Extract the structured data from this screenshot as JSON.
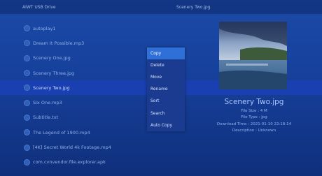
{
  "header": {
    "path": "AIWT USB Drive",
    "title": "Scenery Two.jpg"
  },
  "files": [
    {
      "name": "autoplay1",
      "icon": "folder-icon"
    },
    {
      "name": "Dream It Possible.mp3",
      "icon": "music-file-icon"
    },
    {
      "name": "Scenery One.jpg",
      "icon": "image-file-icon"
    },
    {
      "name": "Scenery Three.jpg",
      "icon": "image-file-icon"
    },
    {
      "name": "Scenery Two.jpg",
      "icon": "image-file-icon",
      "selected": true
    },
    {
      "name": "Six One.mp3",
      "icon": "music-file-icon"
    },
    {
      "name": "Subtitle.txt",
      "icon": "text-file-icon"
    },
    {
      "name": "The Legend of 1900.mp4",
      "icon": "video-file-icon"
    },
    {
      "name": "[4K] Secret World 4k Footage.mp4",
      "icon": "video-file-icon"
    },
    {
      "name": "com.cvnvendor.file.explorer.apk",
      "icon": "apk-file-icon"
    }
  ],
  "menu": {
    "items": [
      "Copy",
      "Delete",
      "Move",
      "Rename",
      "Sort",
      "Search",
      "Auto Copy"
    ],
    "active_index": 0
  },
  "details": {
    "file_name": "Scenery Two.jpg",
    "file_size": "File Size : 4 M",
    "file_type": "File Type : jpg",
    "download_time": "Download Time : 2021-01-10 22:18:14",
    "description": "Description : Unknown"
  },
  "colors": {
    "background": "#1b4aa8",
    "selected_row": "#1a3fb0",
    "menu_active": "#2f6fd8"
  }
}
